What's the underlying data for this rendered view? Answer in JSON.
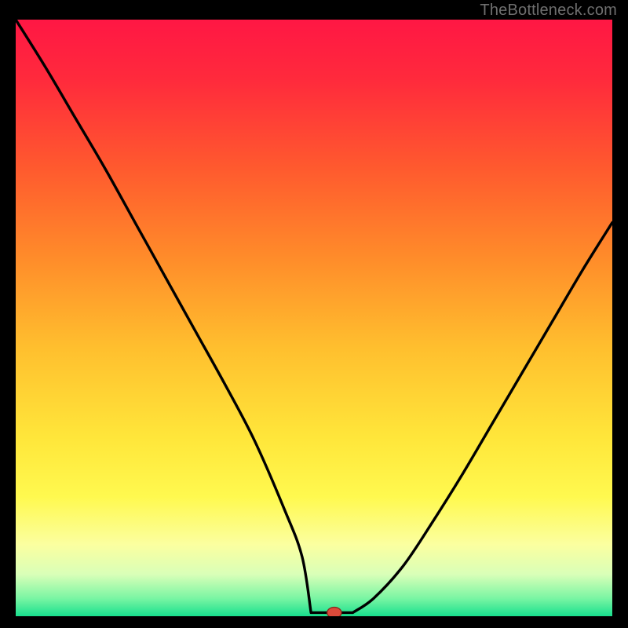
{
  "watermark": "TheBottleneck.com",
  "colors": {
    "curve": "#000000",
    "marker_fill": "#dc4a3a",
    "marker_stroke": "#8a2a20",
    "frame": "#000000",
    "gradient_stops": [
      {
        "offset": 0.0,
        "color": "#ff1744"
      },
      {
        "offset": 0.1,
        "color": "#ff2a3c"
      },
      {
        "offset": 0.25,
        "color": "#ff5a2e"
      },
      {
        "offset": 0.4,
        "color": "#ff8c2a"
      },
      {
        "offset": 0.55,
        "color": "#ffbf2e"
      },
      {
        "offset": 0.7,
        "color": "#ffe63a"
      },
      {
        "offset": 0.8,
        "color": "#fff94f"
      },
      {
        "offset": 0.88,
        "color": "#fbffa0"
      },
      {
        "offset": 0.93,
        "color": "#d9ffb8"
      },
      {
        "offset": 0.97,
        "color": "#7af5a3"
      },
      {
        "offset": 1.0,
        "color": "#18e08e"
      }
    ]
  },
  "chart_data": {
    "type": "line",
    "title": "",
    "xlabel": "",
    "ylabel": "",
    "xlim": [
      0,
      100
    ],
    "ylim": [
      0,
      100
    ],
    "grid": false,
    "series": [
      {
        "name": "bottleneck-curve",
        "x": [
          0,
          5,
          10,
          15,
          20,
          25,
          30,
          35,
          40,
          45,
          48,
          50,
          52,
          53.4,
          56,
          60,
          65,
          70,
          75,
          80,
          85,
          90,
          95,
          100
        ],
        "y": [
          100,
          92,
          83.5,
          75,
          66,
          57,
          48,
          39,
          29.5,
          18,
          10,
          4.5,
          1.2,
          0.6,
          0.6,
          3,
          8.5,
          16,
          24,
          32.5,
          41,
          49.5,
          58,
          66
        ]
      }
    ],
    "flat_segment": {
      "x_start": 49.5,
      "x_end": 56.5,
      "y": 0.6
    },
    "marker": {
      "x": 53.4,
      "y": 0.6,
      "rx": 1.2,
      "ry": 0.9
    }
  }
}
